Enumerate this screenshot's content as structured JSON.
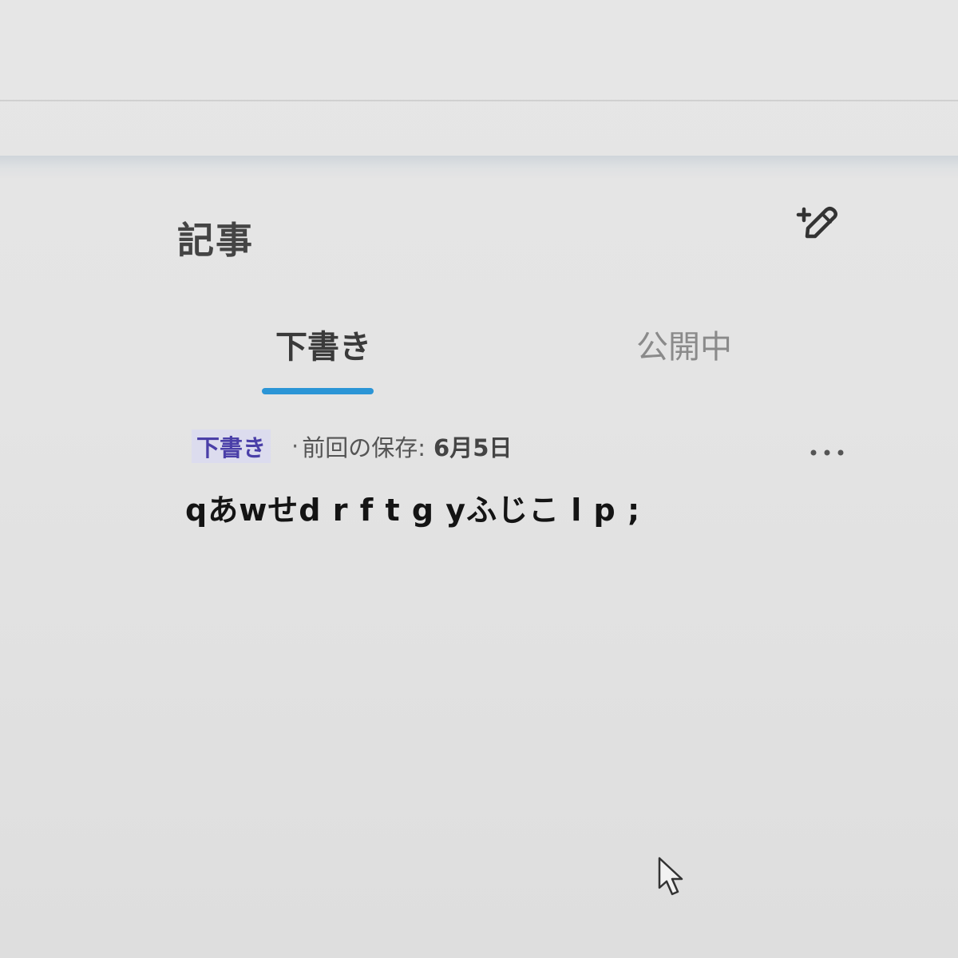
{
  "header": {
    "title": "記事",
    "new_post_icon": "pencil-plus-icon"
  },
  "tabs": [
    {
      "label": "下書き",
      "active": true
    },
    {
      "label": "公開中",
      "active": false
    }
  ],
  "colors": {
    "accent": "#2b95d6",
    "badge_text": "#4a3fa8"
  },
  "post": {
    "status": "下書き",
    "separator": "·",
    "last_saved_label": "前回の保存:",
    "last_saved_date": "6月5日",
    "title": "qあwせd r f t g yふじこ l p ;",
    "more_icon": "more-horizontal-icon"
  },
  "cursor_icon": "mouse-pointer-icon"
}
